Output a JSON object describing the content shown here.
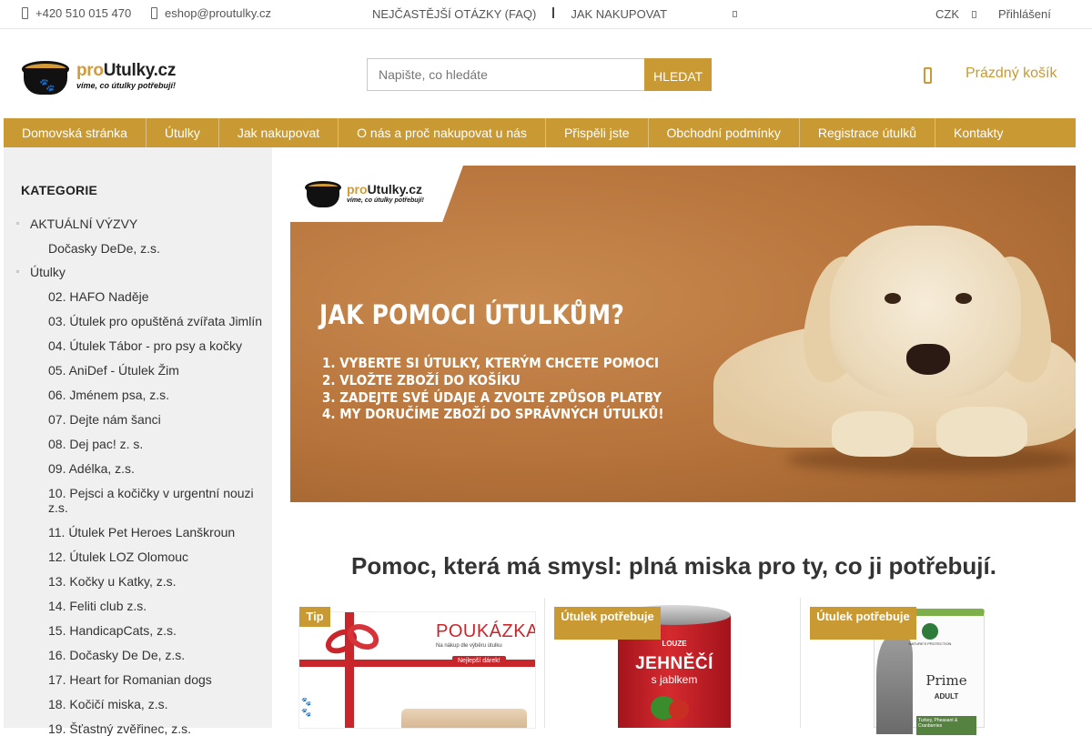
{
  "topbar": {
    "phone": "+420 510 015 470",
    "email": "eshop@proutulky.cz",
    "links": [
      "NEJČASTĚJŠÍ OTÁZKY (FAQ)",
      "JAK NAKUPOVAT"
    ],
    "currency": "CZK",
    "login": "Přihlášení"
  },
  "header": {
    "logo_brand_prefix": "pro",
    "logo_brand_suffix": "Utulky.cz",
    "logo_tagline": "víme, co útulky potřebují!",
    "search_placeholder": "Napište, co hledáte",
    "search_button": "HLEDAT",
    "cart_label": "Prázdný košík"
  },
  "nav": {
    "items": [
      "Domovská stránka",
      "Útulky",
      "Jak nakupovat",
      "O nás a proč nakupovat u nás",
      "Přispěli jste",
      "Obchodní podmínky",
      "Registrace útulků",
      "Kontakty"
    ]
  },
  "sidebar": {
    "title": "KATEGORIE",
    "categories": [
      {
        "label": "AKTUÁLNÍ VÝZVY",
        "level": 1
      },
      {
        "label": "Dočasky DeDe, z.s.",
        "level": 2
      },
      {
        "label": "Útulky",
        "level": 1
      },
      {
        "label": "02. HAFO Naděje",
        "level": 2
      },
      {
        "label": "03. Útulek pro opuštěná zvířata Jimlín",
        "level": 2
      },
      {
        "label": "04. Útulek Tábor - pro psy a kočky",
        "level": 2
      },
      {
        "label": "05. AniDef - Útulek Žim",
        "level": 2
      },
      {
        "label": "06. Jménem psa, z.s.",
        "level": 2
      },
      {
        "label": "07. Dejte nám šanci",
        "level": 2
      },
      {
        "label": "08. Dej pac! z. s.",
        "level": 2
      },
      {
        "label": "09. Adélka, z.s.",
        "level": 2
      },
      {
        "label": "10. Pejsci a kočičky v urgentní nouzi z.s.",
        "level": 2
      },
      {
        "label": "11. Útulek Pet Heroes Lanškroun",
        "level": 2
      },
      {
        "label": "12. Útulek LOZ Olomouc",
        "level": 2
      },
      {
        "label": "13. Kočky u Katky, z.s.",
        "level": 2
      },
      {
        "label": "14. Feliti club z.s.",
        "level": 2
      },
      {
        "label": "15. HandicapCats, z.s.",
        "level": 2
      },
      {
        "label": "16. Dočasky De De, z.s.",
        "level": 2
      },
      {
        "label": "17. Heart for Romanian dogs",
        "level": 2
      },
      {
        "label": "18. Kočičí miska, z.s.",
        "level": 2
      },
      {
        "label": "19. Šťastný zvěřinec, z.s.",
        "level": 2
      }
    ]
  },
  "banner": {
    "logo_brand_prefix": "pro",
    "logo_brand_suffix": "Utulky.cz",
    "logo_tagline": "víme, co útulky potřebují!",
    "headline": "JAK POMOCI ÚTULKŮM?",
    "steps": [
      "1. VYBERTE SI ÚTULKY, KTERÝM CHCETE POMOCI",
      "2. VLOŽTE ZBOŽÍ DO KOŠÍKU",
      "3. ZADEJTE SVÉ ÚDAJE A ZVOLTE ZPŮSOB PLATBY",
      "4. MY DORUČÍME ZBOŽÍ DO SPRÁVNÝCH ÚTULKŮ!"
    ]
  },
  "main": {
    "tagline": "Pomoc, která má smysl: plná miska pro ty, co ji potřebují."
  },
  "products": [
    {
      "badge": "Tip",
      "image": {
        "title": "POUKÁZKA",
        "subtitle": "Na nákup dle výběru útulku",
        "ribbon_label": "Nejlepší dárek!"
      }
    },
    {
      "badge": "Útulek potřebuje",
      "image": {
        "brand": "LOUZE",
        "name": "JEHNĚČÍ",
        "with": "s jablkem"
      }
    },
    {
      "badge": "Útulek potřebuje",
      "image": {
        "brand": "NATURE'S PROTECTION",
        "name": "Prime",
        "line": "ADULT",
        "flavour": "Turkey, Pheasant & Cranberries"
      }
    }
  ],
  "colors": {
    "accent": "#c99a33",
    "sidebar_bg": "#f0f0f0",
    "banner_bg": "#b8763d"
  }
}
